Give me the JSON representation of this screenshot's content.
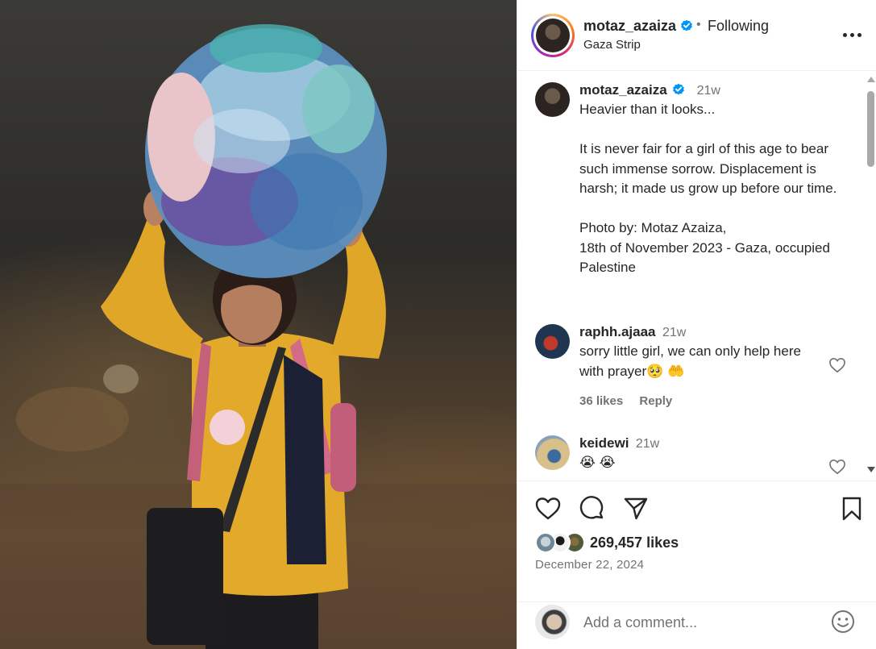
{
  "post": {
    "username": "motaz_azaiza",
    "follow_status": "Following",
    "separator": "•",
    "location": "Gaza Strip",
    "more_icon": "more-horizontal-icon"
  },
  "caption": {
    "username": "motaz_azaiza",
    "time": "21w",
    "text": "Heavier than it looks...\n\nIt is never fair for a girl of this age to bear such immense sorrow. Displacement is harsh; it made us grow up before our time.\n\nPhoto by: Motaz Azaiza,\n18th of November 2023 - Gaza, occupied Palestine"
  },
  "comments": [
    {
      "username": "raphh.ajaaa",
      "time": "21w",
      "text": "sorry little girl, we can only help here with prayer🥺 🤲",
      "likes": "36 likes",
      "reply": "Reply"
    },
    {
      "username": "keidewi",
      "time": "21w",
      "text": "😭 😭"
    }
  ],
  "actions": {
    "likes": "269,457 likes",
    "date": "December 22, 2024"
  },
  "add_comment": {
    "placeholder": "Add a comment..."
  },
  "colors": {
    "verified": "#0095f6",
    "text_primary": "#262626",
    "text_secondary": "#737373"
  }
}
